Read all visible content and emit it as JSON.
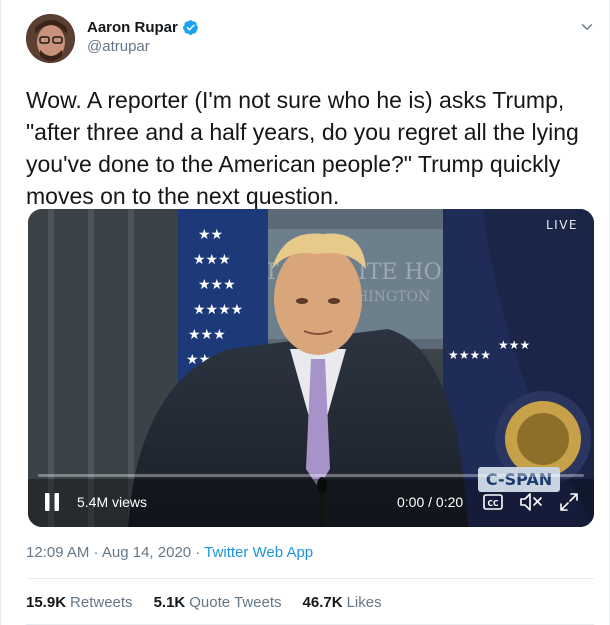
{
  "author": {
    "name": "Aaron Rupar",
    "handle": "@atrupar",
    "verified": true
  },
  "tweet": {
    "text": "Wow. A reporter (I'm not sure who he is) asks Trump,\n\"after three and a half years, do you regret all the lying\nyou've done to the American people?\" Trump quickly\nmoves on to the next question."
  },
  "video": {
    "live_label": "LIVE",
    "watermark": "C-SPAN",
    "views": "5.4M views",
    "time": "0:00 / 0:20",
    "progress": 0.0,
    "backdrop_text_line1": "ITE HOU",
    "backdrop_text_line2": "HINGTON"
  },
  "meta": {
    "timestamp": "12:09 AM · Aug 14, 2020",
    "separator": " · ",
    "source": "Twitter Web App"
  },
  "stats": {
    "retweets_count": "15.9K",
    "retweets_label": "Retweets",
    "quotes_count": "5.1K",
    "quotes_label": "Quote Tweets",
    "likes_count": "46.7K",
    "likes_label": "Likes"
  },
  "colors": {
    "accent": "#1b95e0",
    "muted": "#657786",
    "text": "#14171a",
    "divider": "#e6ecf0"
  }
}
